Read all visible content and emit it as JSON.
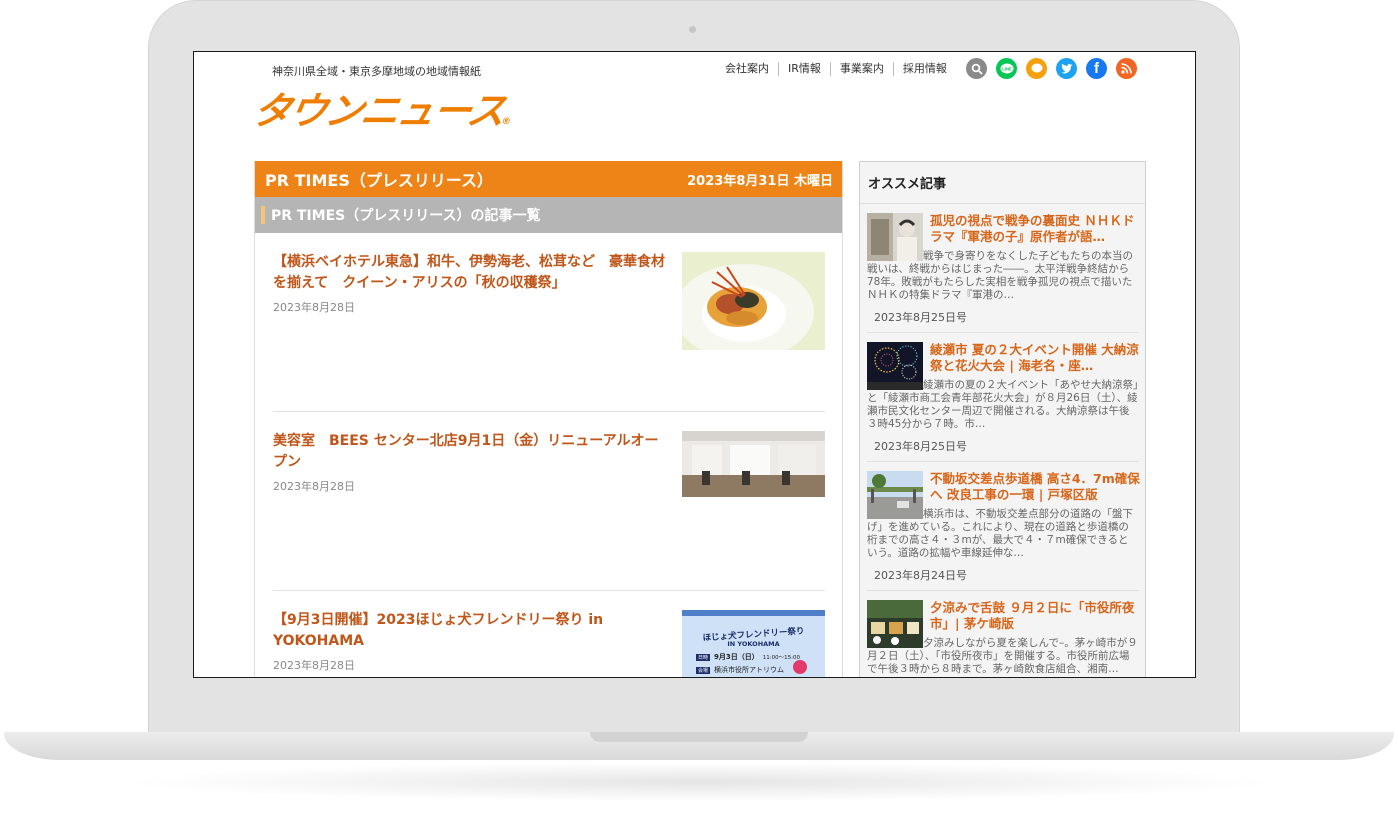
{
  "header": {
    "tagline": "神奈川県全域・東京多摩地域の地域情報紙",
    "logo_text": "タウンニュース",
    "logo_mark": "®",
    "nav": [
      "会社案内",
      "IR情報",
      "事業案内",
      "採用情報"
    ],
    "social": [
      {
        "name": "search",
        "glyph": "⚲",
        "color": "#8a8a8a"
      },
      {
        "name": "line",
        "glyph": "LINE",
        "color": "#06c755"
      },
      {
        "name": "chat",
        "glyph": "●",
        "color": "#f5a10e"
      },
      {
        "name": "twitter",
        "glyph": "t",
        "color": "#1da1f2"
      },
      {
        "name": "facebook",
        "glyph": "f",
        "color": "#1877f2"
      },
      {
        "name": "rss",
        "glyph": "◉",
        "color": "#f26522"
      }
    ]
  },
  "main": {
    "section_title": "PR TIMES（プレスリリース）",
    "date": "2023年8月31日 木曜日",
    "list_title": "PR TIMES（プレスリリース）の記事一覧",
    "articles": [
      {
        "title": "【横浜ベイホテル東急】和牛、伊勢海老、松茸など　豪華食材を揃えて　クイーン・アリスの「秋の収穫祭」",
        "date": "2023年8月28日"
      },
      {
        "title": "美容室　BEES センター北店9月1日（金）リニューアルオープン",
        "date": "2023年8月28日"
      },
      {
        "title": "【9月3日開催】2023ほじょ犬フレンドリー祭り in YOKOHAMA",
        "date": "2023年8月28日"
      }
    ],
    "poster": {
      "title": "ほじょ犬フレンドリー祭り",
      "sub": "IN YOKOHAMA",
      "date_label": "日時",
      "date": "9月3日（日）",
      "time": "11:00〜15:00",
      "place_label": "会場",
      "place": "横浜市役所アトリウム"
    }
  },
  "sidebar": {
    "title": "オススメ記事",
    "items": [
      {
        "title": "孤児の視点で戦争の裏面史 ＮＨＫドラマ『軍港の子』原作者が語…",
        "body": "戦争で身寄りをなくした子どもたちの本当の戦いは、終戦からはじまった――。太平洋戦争終結から78年。敗戦がもたらした実相を戦争孤児の視点で描いたＮＨＫの特集ドラマ『軍港の…",
        "date": "2023年8月25日号"
      },
      {
        "title": "綾瀬市 夏の２大イベント開催 大納涼祭と花火大会 | 海老名・座…",
        "body": "綾瀬市の夏の２大イベント「あやせ大納涼祭」と「綾瀬市商工会青年部花火大会」が８月26日（土）、綾瀬市民文化センター周辺で開催される。大納涼祭は午後３時45分から７時。市…",
        "date": "2023年8月25日号"
      },
      {
        "title": "不動坂交差点歩道橋 高さ4．7m確保へ 改良工事の一環 | 戸塚区版",
        "body": "横浜市は、不動坂交差点部分の道路の「盤下げ」を進めている。これにより、現在の道路と歩道橋の桁までの高さ４・３mが、最大で４・７m確保できるという。道路の拡幅や車線延伸な…",
        "date": "2023年8月24日号"
      },
      {
        "title": "夕涼みで舌鼓 ９月２日に「市役所夜市」| 茅ケ崎版",
        "body": "夕涼みしながら夏を楽しんで–。茅ヶ崎市が９月２日（土）、「市役所夜市」を開催する。市役所前広場で午後３時から８時まで。茅ヶ崎飲食店組合、湘南…",
        "date": ""
      }
    ]
  }
}
